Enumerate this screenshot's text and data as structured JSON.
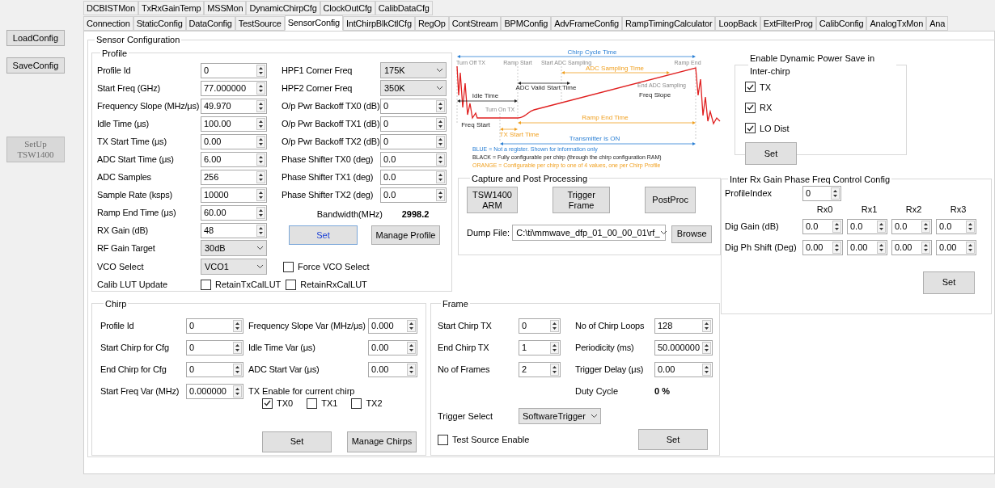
{
  "sidebar": {
    "buttons": [
      {
        "label": "LoadConfig",
        "disabled": false
      },
      {
        "label": "SaveConfig",
        "disabled": false
      },
      {
        "label": "SetUp TSW1400",
        "disabled": true
      }
    ]
  },
  "tabs": {
    "row_1": [
      {
        "label": "DCBISTMon",
        "selected": false
      },
      {
        "label": "TxRxGainTemp",
        "selected": false
      },
      {
        "label": "MSSMon",
        "selected": false
      },
      {
        "label": "DynamicChirpCfg",
        "selected": false
      },
      {
        "label": "ClockOutCfg",
        "selected": false
      },
      {
        "label": "CalibDataCfg",
        "selected": false
      }
    ],
    "row_2": [
      {
        "label": "Connection",
        "selected": false
      },
      {
        "label": "StaticConfig",
        "selected": false
      },
      {
        "label": "DataConfig",
        "selected": false
      },
      {
        "label": "TestSource",
        "selected": false
      },
      {
        "label": "SensorConfig",
        "selected": true
      },
      {
        "label": "IntChirpBlkCtlCfg",
        "selected": false
      },
      {
        "label": "RegOp",
        "selected": false
      },
      {
        "label": "ContStream",
        "selected": false
      },
      {
        "label": "BPMConfig",
        "selected": false
      },
      {
        "label": "AdvFrameConfig",
        "selected": false
      },
      {
        "label": "RampTimingCalculator",
        "selected": false
      },
      {
        "label": "LoopBack",
        "selected": false
      },
      {
        "label": "ExtFilterProg",
        "selected": false
      },
      {
        "label": "CalibConfig",
        "selected": false
      },
      {
        "label": "AnalogTxMon",
        "selected": false
      },
      {
        "label": "Ana",
        "selected": false
      }
    ]
  },
  "sensor_configuration": {
    "title": "Sensor Configuration",
    "profile": {
      "title": "Profile",
      "left_fields": [
        {
          "label": "Profile Id",
          "value": "0",
          "kind": "spin"
        },
        {
          "label": "Start Freq (GHz)",
          "value": "77.000000",
          "kind": "spin"
        },
        {
          "label": "Frequency Slope (MHz/μs)",
          "value": "49.970",
          "kind": "spin"
        },
        {
          "label": "Idle Time (μs)",
          "value": "100.00",
          "kind": "spin"
        },
        {
          "label": "TX Start Time (μs)",
          "value": "0.00",
          "kind": "spin"
        },
        {
          "label": "ADC Start Time (μs)",
          "value": "6.00",
          "kind": "spin"
        },
        {
          "label": "ADC Samples",
          "value": "256",
          "kind": "spin"
        },
        {
          "label": "Sample Rate (ksps)",
          "value": "10000",
          "kind": "spin"
        },
        {
          "label": "Ramp End Time (μs)",
          "value": "60.00",
          "kind": "spin"
        },
        {
          "label": "RX Gain (dB)",
          "value": "48",
          "kind": "spin"
        },
        {
          "label": "RF Gain Target",
          "value": "30dB",
          "kind": "select"
        }
      ],
      "right_fields": [
        {
          "label": "HPF1 Corner Freq",
          "value": "175K",
          "kind": "select"
        },
        {
          "label": "HPF2 Corner Freq",
          "value": "350K",
          "kind": "select"
        },
        {
          "label": "O/p Pwr Backoff TX0 (dB)",
          "value": "0",
          "kind": "spin"
        },
        {
          "label": "O/p Pwr Backoff TX1 (dB)",
          "value": "0",
          "kind": "spin"
        },
        {
          "label": "O/p Pwr Backoff TX2 (dB)",
          "value": "0",
          "kind": "spin"
        },
        {
          "label": "Phase Shifter TX0 (deg)",
          "value": "0.0",
          "kind": "spin"
        },
        {
          "label": "Phase Shifter TX1 (deg)",
          "value": "0.0",
          "kind": "spin"
        },
        {
          "label": "Phase Shifter TX2 (deg)",
          "value": "0.0",
          "kind": "spin"
        }
      ],
      "bandwidth": {
        "label": "Bandwidth(MHz)",
        "value": "2998.2"
      },
      "buttons": [
        {
          "label": "Set",
          "focused": true
        },
        {
          "label": "Manage Profile",
          "focused": false
        }
      ],
      "vco": {
        "label": "VCO Select",
        "value": "VCO1",
        "force": {
          "label": "Force VCO Select",
          "checked": false
        }
      },
      "calib": {
        "label": "Calib LUT Update",
        "options": [
          {
            "label": "RetainTxCalLUT",
            "checked": false
          },
          {
            "label": "RetainRxCalLUT",
            "checked": false
          }
        ]
      }
    },
    "diagram": {
      "labels": [
        {
          "text": "Chirp Cycle Time",
          "kind": "info"
        },
        {
          "text": "Turn Off TX",
          "kind": "marker"
        },
        {
          "text": "Ramp Start",
          "kind": "marker"
        },
        {
          "text": "Start ADC Sampling",
          "kind": "marker"
        },
        {
          "text": "Ramp End",
          "kind": "marker"
        },
        {
          "text": "ADC Sampling Time",
          "kind": "profile"
        },
        {
          "text": "ADC Valid Start Time",
          "kind": "chirp"
        },
        {
          "text": "End ADC Sampling",
          "kind": "marker"
        },
        {
          "text": "Idle Time",
          "kind": "chirp"
        },
        {
          "text": "Freq Slope",
          "kind": "chirp"
        },
        {
          "text": "Turn On TX",
          "kind": "marker"
        },
        {
          "text": "Freq Start",
          "kind": "chirp"
        },
        {
          "text": "Ramp End Time",
          "kind": "profile"
        },
        {
          "text": "TX Start Time",
          "kind": "profile"
        },
        {
          "text": "Transmitter is ON",
          "kind": "info"
        }
      ],
      "legend": [
        {
          "text": "BLUE = Not a register. Shown for information only",
          "kind": "info"
        },
        {
          "text": "BLACK = Fully configurable per chirp (through the chirp configuration RAM)",
          "kind": "chirp"
        },
        {
          "text": "ORANGE = Configurable per chirp to one of 4 values, one per Chirp Profile",
          "kind": "profile"
        }
      ]
    },
    "capture": {
      "title": "Capture and Post Processing",
      "buttons": [
        "TSW1400 ARM",
        "Trigger Frame",
        "PostProc"
      ],
      "dump_file": {
        "label": "Dump File:",
        "value": "C:\\ti\\mmwave_dfp_01_00_00_01\\rf_"
      },
      "browse": "Browse"
    },
    "dynamic_power_save": {
      "title": "Enable Dynamic Power Save in Inter-chirp",
      "options": [
        {
          "label": "TX",
          "checked": true
        },
        {
          "label": "RX",
          "checked": true
        },
        {
          "label": "LO Dist",
          "checked": true
        }
      ],
      "button": "Set"
    },
    "inter_rx": {
      "title": "Inter Rx Gain Phase Freq Control Config",
      "profile_index": {
        "label": "ProfileIndex",
        "value": "0"
      },
      "columns": [
        "Rx0",
        "Rx1",
        "Rx2",
        "Rx3"
      ],
      "rows": [
        {
          "label": "Dig Gain (dB)",
          "values": [
            "0.0",
            "0.0",
            "0.0",
            "0.0"
          ]
        },
        {
          "label": "Dig Ph Shift (Deg)",
          "values": [
            "0.00",
            "0.00",
            "0.00",
            "0.00"
          ]
        }
      ],
      "button": "Set"
    },
    "chirp": {
      "title": "Chirp",
      "left_fields": [
        {
          "label": "Profile Id",
          "value": "0"
        },
        {
          "label": "Start Chirp for Cfg",
          "value": "0"
        },
        {
          "label": "End Chirp for Cfg",
          "value": "0"
        },
        {
          "label": "Start Freq Var (MHz)",
          "value": "0.000000"
        }
      ],
      "right_fields": [
        {
          "label": "Frequency Slope Var (MHz/μs)",
          "value": "0.000"
        },
        {
          "label": "Idle Time Var (μs)",
          "value": "0.00"
        },
        {
          "label": "ADC Start Var (μs)",
          "value": "0.00"
        }
      ],
      "tx_enable": {
        "label": "TX Enable for current chirp",
        "options": [
          {
            "label": "TX0",
            "checked": true
          },
          {
            "label": "TX1",
            "checked": false
          },
          {
            "label": "TX2",
            "checked": false
          }
        ]
      },
      "buttons": [
        "Set",
        "Manage Chirps"
      ]
    },
    "frame": {
      "title": "Frame",
      "left_fields": [
        {
          "label": "Start Chirp TX",
          "value": "0"
        },
        {
          "label": "End Chirp TX",
          "value": "1"
        },
        {
          "label": "No of Frames",
          "value": "2"
        }
      ],
      "right_fields": [
        {
          "label": "No of Chirp Loops",
          "value": "128"
        },
        {
          "label": "Periodicity (ms)",
          "value": "50.000000"
        },
        {
          "label": "Trigger Delay (μs)",
          "value": "0.00"
        }
      ],
      "duty_cycle": {
        "label": "Duty Cycle",
        "value": "0 %"
      },
      "trigger_select": {
        "label": "Trigger Select",
        "value": "SoftwareTrigger"
      },
      "test_source": {
        "label": "Test Source Enable",
        "checked": false
      },
      "button": "Set"
    }
  }
}
